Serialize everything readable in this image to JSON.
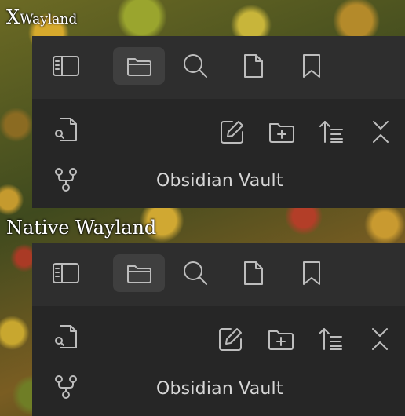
{
  "captions": {
    "top_prefix": "X",
    "top_rest": "Wayland",
    "bottom": "Native Wayland"
  },
  "panels": [
    {
      "id": "xwayland",
      "toolbar_tabs": [
        "sidebar-toggle",
        "files",
        "search",
        "file",
        "bookmarks"
      ],
      "active_tab": "files",
      "left_rail": [
        "open-quick-switcher",
        "graph-view"
      ],
      "actions": [
        "new-note",
        "new-folder",
        "sort",
        "collapse-all"
      ],
      "vault_title": "Obsidian Vault"
    },
    {
      "id": "native-wayland",
      "toolbar_tabs": [
        "sidebar-toggle",
        "files",
        "search",
        "file",
        "bookmarks"
      ],
      "active_tab": "files",
      "left_rail": [
        "open-quick-switcher",
        "graph-view"
      ],
      "actions": [
        "new-note",
        "new-folder",
        "sort",
        "collapse-all"
      ],
      "vault_title": "Obsidian Vault"
    }
  ],
  "colors": {
    "panel_bg": "#262626",
    "toolbar_bg": "#2e2e2e",
    "active_tab_bg": "#3f3f3f",
    "icon": "#bdbdbd",
    "text": "#d6d6d6"
  }
}
